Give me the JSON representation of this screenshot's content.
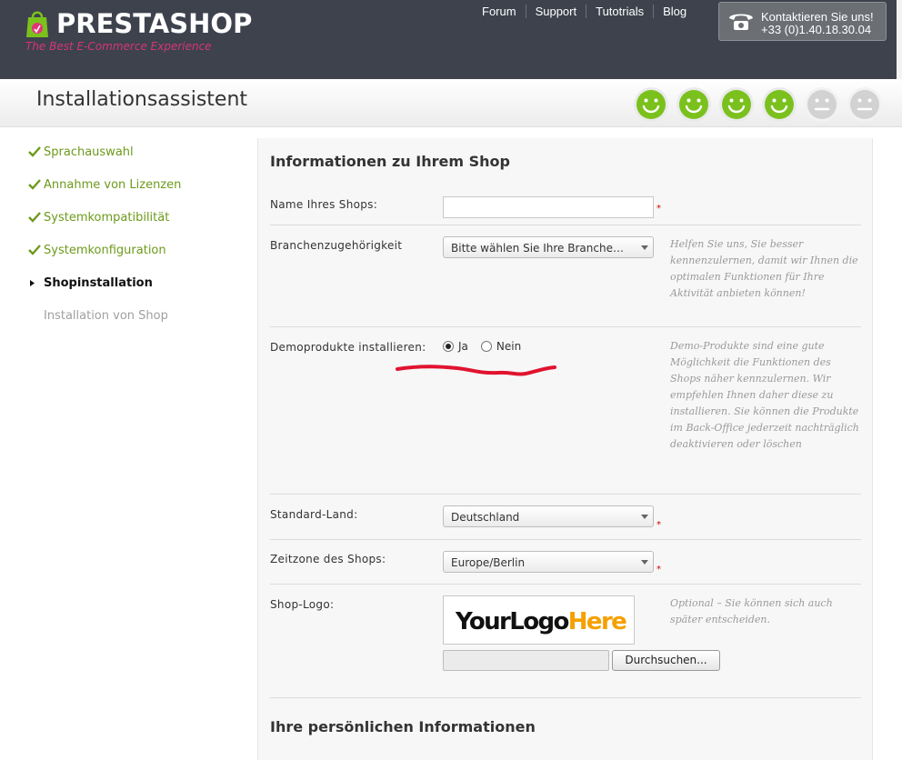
{
  "header": {
    "logo_text_presta": "PRESTA",
    "logo_text_shop": "SHOP",
    "logo_tagline": "The Best E-Commerce Experience",
    "nav": [
      "Forum",
      "Support",
      "Tutotrials",
      "Blog"
    ],
    "contact_line1": "Kontaktieren Sie uns!",
    "contact_line2": "+33 (0)1.40.18.30.04"
  },
  "title": "Installationsassistent",
  "progress": {
    "completed_steps": 4,
    "total_steps": 6,
    "colors": {
      "done": "#7bc11e",
      "todo": "#d2d2d2"
    }
  },
  "sidebar": {
    "items": [
      {
        "label": "Sprachauswahl",
        "state": "done"
      },
      {
        "label": "Annahme von Lizenzen",
        "state": "done"
      },
      {
        "label": "Systemkompatibilität",
        "state": "done"
      },
      {
        "label": "Systemkonfiguration",
        "state": "done"
      },
      {
        "label": "Shopinstallation",
        "state": "current"
      },
      {
        "label": "Installation von Shop",
        "state": "todo"
      }
    ]
  },
  "form": {
    "section_title": "Informationen zu Ihrem Shop",
    "shop_name": {
      "label": "Name Ihres Shops:",
      "value": "",
      "required_mark": "*"
    },
    "industry": {
      "label": "Branchenzugehörigkeit",
      "selected": "Bitte wählen Sie Ihre Branchenzugehörigkeit",
      "hint": "Helfen Sie uns, Sie besser kennenzulernen, damit wir Ihnen die optimalen Funktionen für Ihre Aktivität anbieten können!"
    },
    "demo_products": {
      "label": "Demoprodukte installieren:",
      "options": [
        "Ja",
        "Nein"
      ],
      "selected": "Ja",
      "hint": "Demo-Produkte sind eine gute Möglichkeit die Funktionen des Shops näher kennzulernen. Wir empfehlen Ihnen daher diese zu installieren. Sie können die Produkte im Back-Office jederzeit nachträglich deaktivieren oder löschen"
    },
    "country": {
      "label": "Standard-Land:",
      "selected": "Deutschland",
      "required_mark": "*"
    },
    "timezone": {
      "label": "Zeitzone des Shops:",
      "selected": "Europe/Berlin",
      "required_mark": "*"
    },
    "shop_logo": {
      "label": "Shop-Logo:",
      "placeholder_text_a": "YourLogo",
      "placeholder_text_b": "Here",
      "hint": "Optional – Sie können sich auch später entscheiden.",
      "browse_label": "Durchsuchen..."
    },
    "personal_section_title": "Ihre persönlichen Informationen"
  },
  "annotation_color": "#e0132f"
}
